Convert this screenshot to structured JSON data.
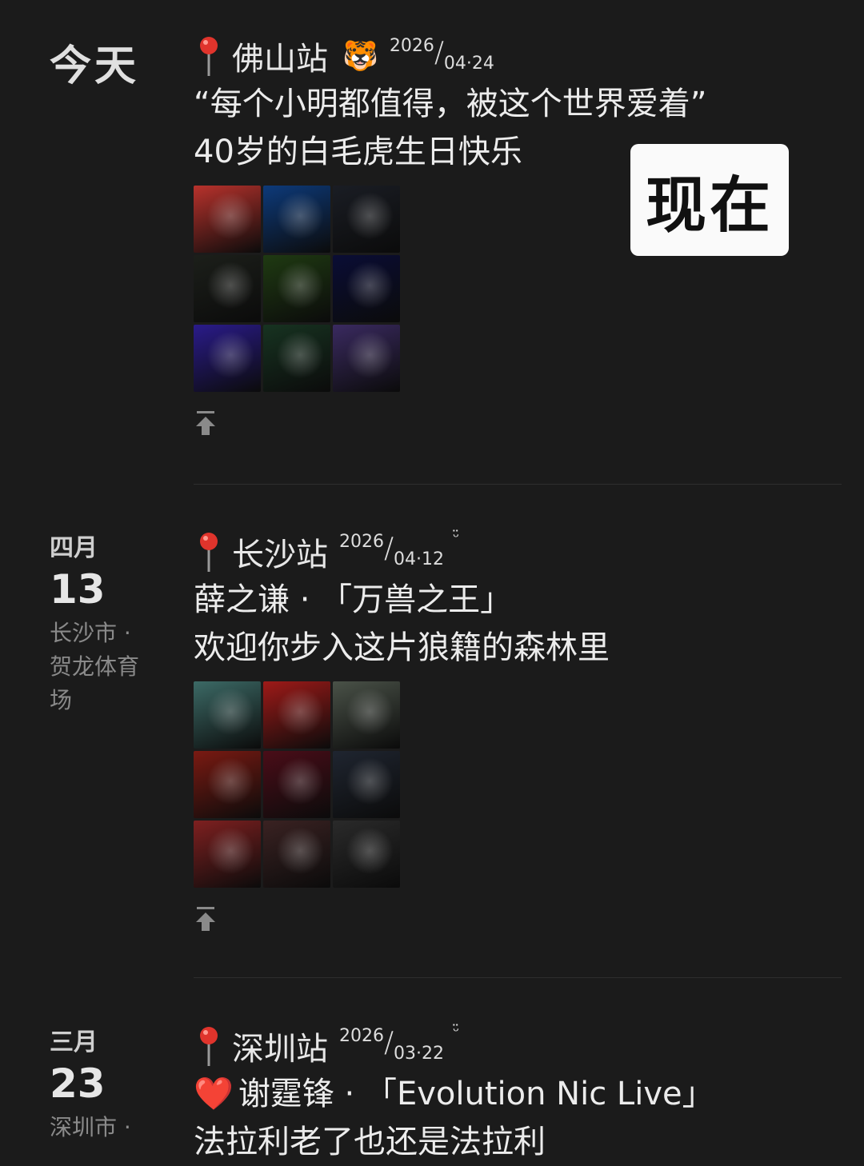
{
  "now_badge": "现在",
  "entries": [
    {
      "date_label": "今天",
      "station": "佛山站",
      "year": "2026",
      "md": "04·24",
      "lines": [
        "“每个小明都值得，被这个世界爱着”",
        "40岁的白毛虎生日快乐"
      ],
      "grid_colors": [
        "#b8322c",
        "#0d3a7a",
        "#1a1d24",
        "#1c1f1a",
        "#1f3a12",
        "#0a0d35",
        "#2a1b8a",
        "#173321",
        "#3a2a60"
      ]
    },
    {
      "month": "四月",
      "day": "13",
      "location": "长沙市 · 贺龙体育场",
      "station": "长沙站",
      "year": "2026",
      "md": "04·12",
      "smile": "ᵕ̈",
      "lines": [
        "薛之谦 · 「万兽之王」",
        "欢迎你步入这片狼籍的森林里"
      ],
      "grid_colors": [
        "#3c6a66",
        "#9e1a18",
        "#4a5248",
        "#7a1a12",
        "#4a0d18",
        "#1f2530",
        "#7e2020",
        "#3a2222",
        "#2a2a2a"
      ]
    },
    {
      "month": "三月",
      "day": "23",
      "location": "深圳市 ·",
      "station": "深圳站",
      "year": "2026",
      "md": "03·22",
      "smile": "ᵕ̈",
      "heart": "❤️",
      "lines": [
        "谢霆锋 · 「Evolution Nic Live」",
        "法拉利老了也还是法拉利"
      ]
    }
  ]
}
